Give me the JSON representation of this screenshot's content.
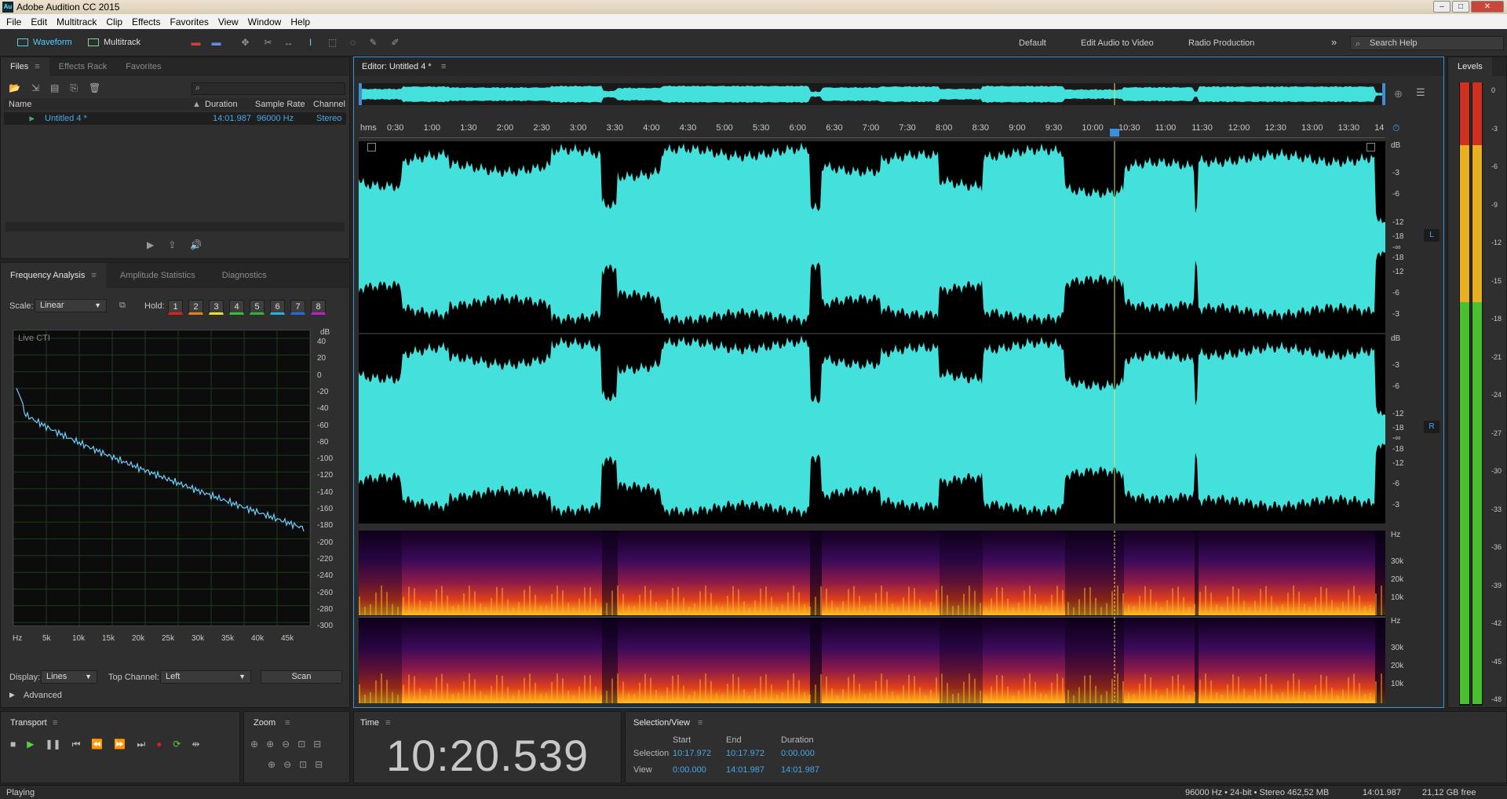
{
  "window": {
    "app_icon": "Au",
    "title": "Adobe Audition CC 2015"
  },
  "menu": [
    "File",
    "Edit",
    "Multitrack",
    "Clip",
    "Effects",
    "Favorites",
    "View",
    "Window",
    "Help"
  ],
  "toolbar": {
    "waveform_label": "Waveform",
    "multitrack_label": "Multitrack",
    "workspaces": [
      "Default",
      "Edit Audio to Video",
      "Radio Production"
    ],
    "more": "»",
    "search_placeholder": "Search Help"
  },
  "files_panel": {
    "tabs": [
      "Files",
      "Effects Rack",
      "Favorites"
    ],
    "columns": [
      "Name",
      "Duration",
      "Sample Rate",
      "Channel"
    ],
    "rows": [
      {
        "name": "Untitled 4 *",
        "duration": "14:01.987",
        "sample_rate": "96000 Hz",
        "channel": "Stereo"
      }
    ]
  },
  "analysis_panel": {
    "tabs": [
      "Frequency Analysis",
      "Amplitude Statistics",
      "Diagnostics"
    ],
    "scale_label": "Scale:",
    "scale_value": "Linear",
    "hold_label": "Hold:",
    "hold_buttons": [
      "1",
      "2",
      "3",
      "4",
      "5",
      "6",
      "7",
      "8"
    ],
    "hold_colors": [
      "#e02020",
      "#e8801c",
      "#e8e020",
      "#38c038",
      "#38b038",
      "#2ab0e0",
      "#2a6ae0",
      "#c020c0"
    ],
    "plot_caption": "Live CTI",
    "y_unit": "dB",
    "y_ticks": [
      "40",
      "20",
      "0",
      "-20",
      "-40",
      "-60",
      "-80",
      "-100",
      "-120",
      "-140",
      "-160",
      "-180",
      "-200",
      "-220",
      "-240",
      "-260",
      "-280",
      "-300"
    ],
    "x_ticks": [
      "Hz",
      "5k",
      "10k",
      "15k",
      "20k",
      "25k",
      "30k",
      "35k",
      "40k",
      "45k"
    ],
    "display_label": "Display:",
    "display_value": "Lines",
    "top_channel_label": "Top Channel:",
    "top_channel_value": "Left",
    "scan_label": "Scan",
    "advanced_label": "Advanced"
  },
  "editor": {
    "tab_label": "Editor: Untitled 4 *",
    "ruler_unit": "hms",
    "ruler_ticks": [
      "0:30",
      "1:00",
      "1:30",
      "2:00",
      "2:30",
      "3:00",
      "3:30",
      "4:00",
      "4:30",
      "5:00",
      "5:30",
      "6:00",
      "6:30",
      "7:00",
      "7:30",
      "8:00",
      "8:30",
      "9:00",
      "9:30",
      "10:00",
      "10:30",
      "11:00",
      "11:30",
      "12:00",
      "12:30",
      "13:00",
      "13:30",
      "14"
    ],
    "db_unit": "dB",
    "db_ticks_top": [
      "-3",
      "-6",
      "-12",
      "-18",
      "-∞",
      "-18",
      "-12",
      "-6",
      "-3"
    ],
    "channel_left": "L",
    "channel_right": "R",
    "hz_unit": "Hz",
    "hz_ticks": [
      "30k",
      "20k",
      "10k"
    ],
    "playhead_time": "10:17.972",
    "waveform_color": "#44e0dc"
  },
  "levels": {
    "title": "Levels",
    "ticks": [
      "0",
      "-3",
      "-6",
      "-9",
      "-12",
      "-15",
      "-18",
      "-21",
      "-24",
      "-27",
      "-30",
      "-33",
      "-36",
      "-39",
      "-42",
      "-45",
      "-48",
      "dB"
    ]
  },
  "transport": {
    "title": "Transport"
  },
  "zoom": {
    "title": "Zoom"
  },
  "time_panel": {
    "title": "Time",
    "value": "10:20.539"
  },
  "selection_view": {
    "title": "Selection/View",
    "headers": [
      "Start",
      "End",
      "Duration"
    ],
    "selection_label": "Selection",
    "selection": [
      "10:17.972",
      "10:17.972",
      "0:00.000"
    ],
    "view_label": "View",
    "view": [
      "0:00.000",
      "14:01.987",
      "14:01.987"
    ]
  },
  "status": {
    "state": "Playing",
    "format": "96000 Hz • 24-bit • Stereo",
    "size": "462,52 MB",
    "duration": "14:01.987",
    "free": "21,12 GB free"
  }
}
